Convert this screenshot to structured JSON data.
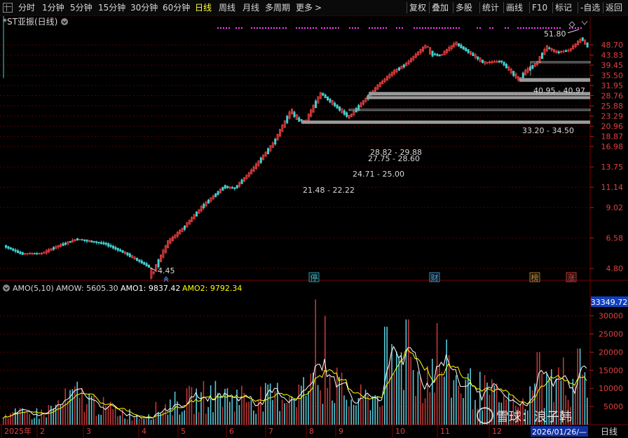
{
  "toolbar": {
    "menu_icon": "grid-menu-icon",
    "left_items": [
      "分时",
      "1分钟",
      "5分钟",
      "15分钟",
      "30分钟",
      "60分钟",
      "日线",
      "周线",
      "月线",
      "多周期",
      "更多"
    ],
    "active": "日线",
    "right_items": [
      "复权",
      "叠加",
      "多股",
      "统计",
      "画线",
      "F10",
      "标记",
      "-自选",
      "返回"
    ]
  },
  "stock": {
    "title": "*ST亚振(日线)",
    "collapse_icon": "chevron-down-icon"
  },
  "price_axis": {
    "ticks": [
      "48.70",
      "43.83",
      "39.45",
      "35.50",
      "31.95",
      "28.76",
      "25.88",
      "23.29",
      "20.96",
      "18.87",
      "16.98",
      "13.75",
      "11.14",
      "9.02",
      "6.58",
      "4.80"
    ]
  },
  "annotations": {
    "low": "4.45",
    "high": "51.80",
    "gaps": [
      "21.48 - 22.22",
      "24.71 - 25.00",
      "27.75 - 28.60",
      "28.82 - 29.88",
      "33.20 - 34.50",
      "40.95 - 40.97"
    ]
  },
  "event_markers": [
    {
      "text": "停",
      "color": "#30b8c8"
    },
    {
      "text": "财",
      "color": "#4aa8e8"
    },
    {
      "text": "榜",
      "color": "#c88a30"
    },
    {
      "text": "涨",
      "color": "#e04040"
    }
  ],
  "indicator": {
    "name": "AMO(5,10)",
    "amow": "AMOW: 5605.30",
    "amo1": "AMO1: 9837.42",
    "amo2": "AMO2: 9792.34",
    "current_value": "33349.72",
    "ticks": [
      "30000",
      "25000",
      "20000",
      "15000",
      "10000",
      "5000"
    ]
  },
  "time_axis": {
    "labels": [
      "2025年",
      "2",
      "3",
      "4",
      "5",
      "6",
      "7",
      "8",
      "9",
      "10",
      "11",
      "12"
    ],
    "current_date": "2026/01/26/—",
    "period": "日线"
  },
  "watermark": "雪球：浪子韩",
  "colors": {
    "up": "#f04040",
    "down": "#40d0d0",
    "grid": "#5a0000",
    "amo1": "#ffffff",
    "amo2": "#ffff00",
    "accent": "#ff40ff"
  }
}
